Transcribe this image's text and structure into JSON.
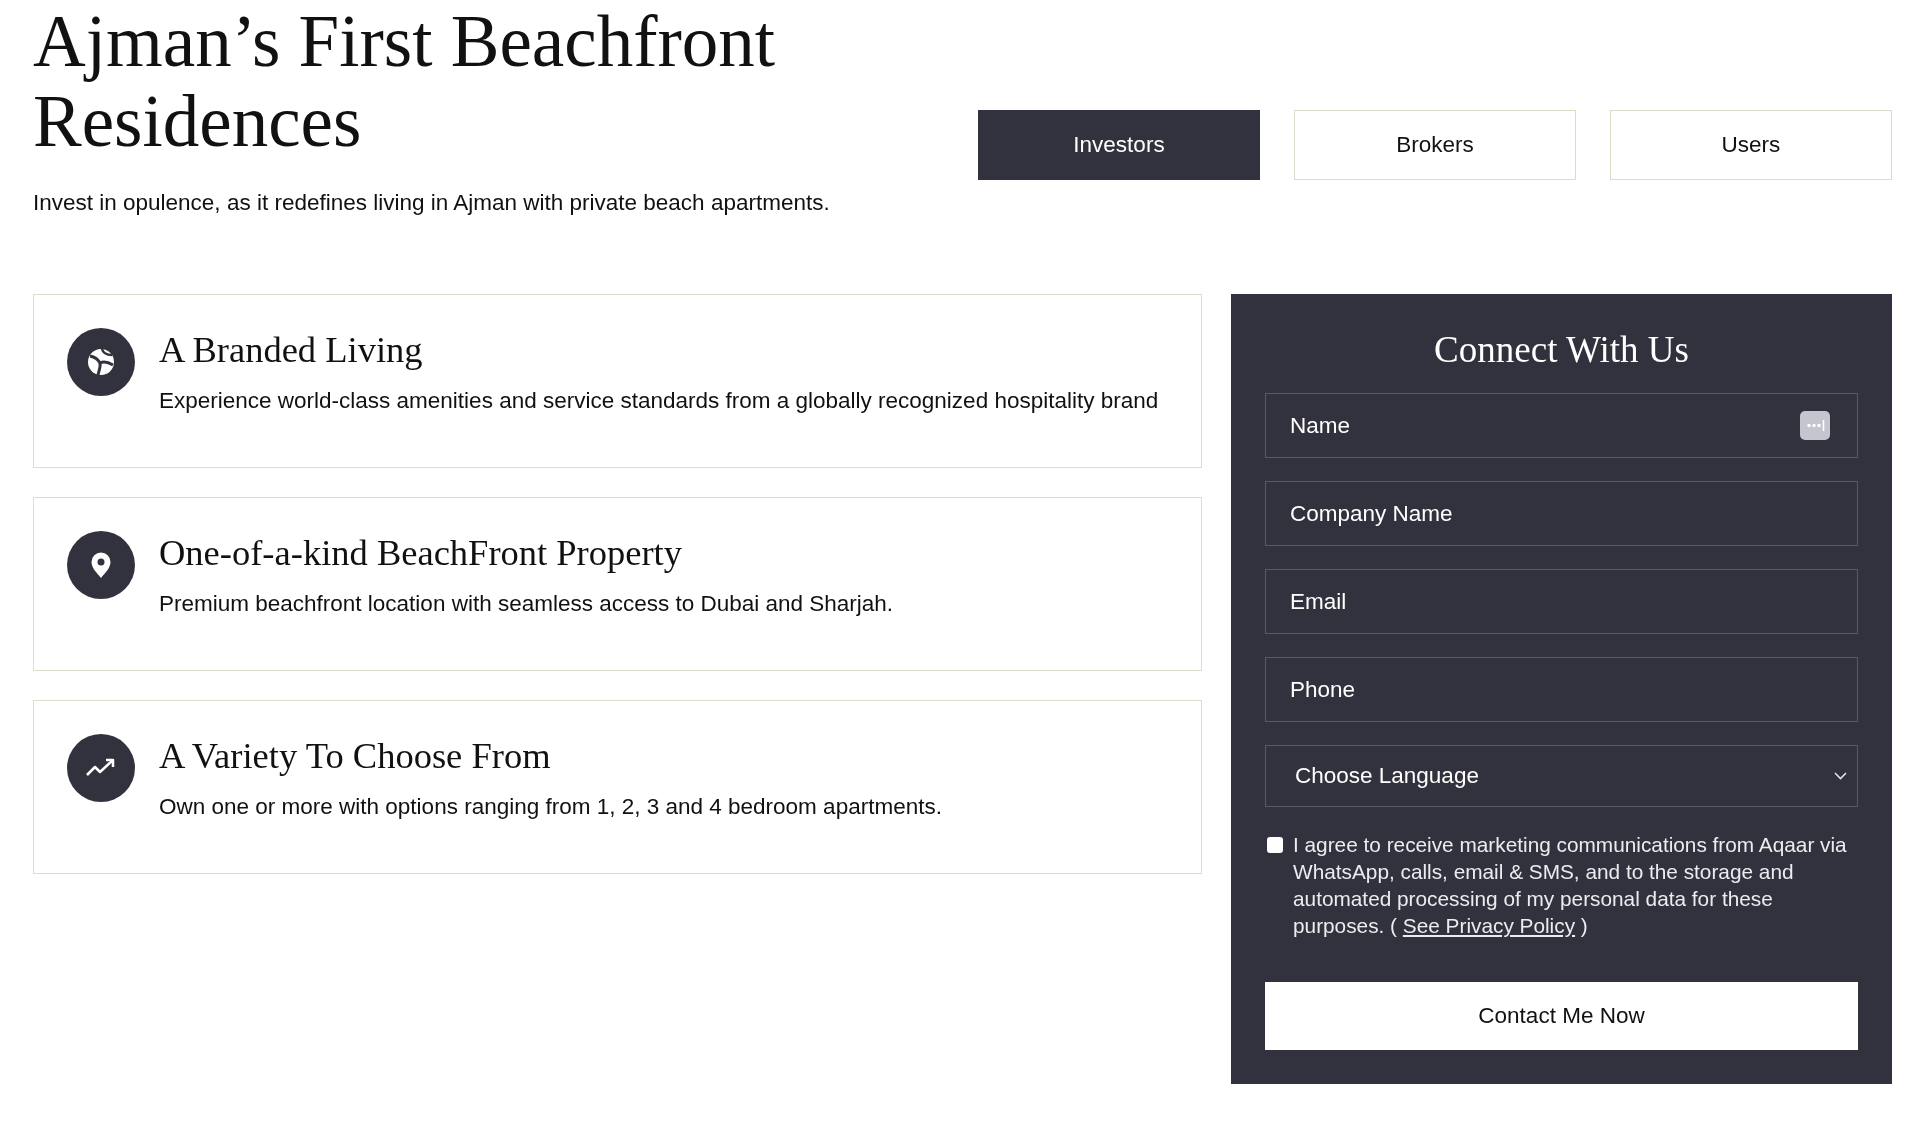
{
  "header": {
    "title": "Ajman’s First Beachfront Residences",
    "subtitle": "Invest in opulence, as it redefines living in Ajman with private beach apartments."
  },
  "tabs": [
    {
      "label": "Investors",
      "selected": true
    },
    {
      "label": "Brokers",
      "selected": false
    },
    {
      "label": "Users",
      "selected": false
    }
  ],
  "features": [
    {
      "kind": "globe",
      "title": "A Branded Living",
      "description": "Experience world-class amenities and service standards from a globally recognized hospitality brand"
    },
    {
      "kind": "pin",
      "title": "One-of-a-kind BeachFront Property",
      "description": "Premium beachfront location with seamless access to Dubai and Sharjah."
    },
    {
      "kind": "trend",
      "title": "A Variety To Choose From",
      "description": "Own one or more with options ranging from 1, 2, 3 and 4 bedroom apartments."
    }
  ],
  "contact_form": {
    "title": "Connect With Us",
    "fields": [
      {
        "kind": "text",
        "placeholder": "Name",
        "autofill": true
      },
      {
        "kind": "text",
        "placeholder": "Company Name",
        "autofill": false
      },
      {
        "kind": "text",
        "placeholder": "Email",
        "autofill": false
      },
      {
        "kind": "text",
        "placeholder": "Phone",
        "autofill": false
      },
      {
        "kind": "select",
        "placeholder": "Choose Language",
        "autofill": false
      }
    ],
    "consent": {
      "checked": false,
      "text": "I agree to receive marketing communications from Aqaar via WhatsApp, calls, email & SMS, and to the storage and automated processing of my personal data for these purposes. (",
      "link": "See Privacy Policy",
      "text_after": ")"
    },
    "submit": "Contact Me Now"
  }
}
